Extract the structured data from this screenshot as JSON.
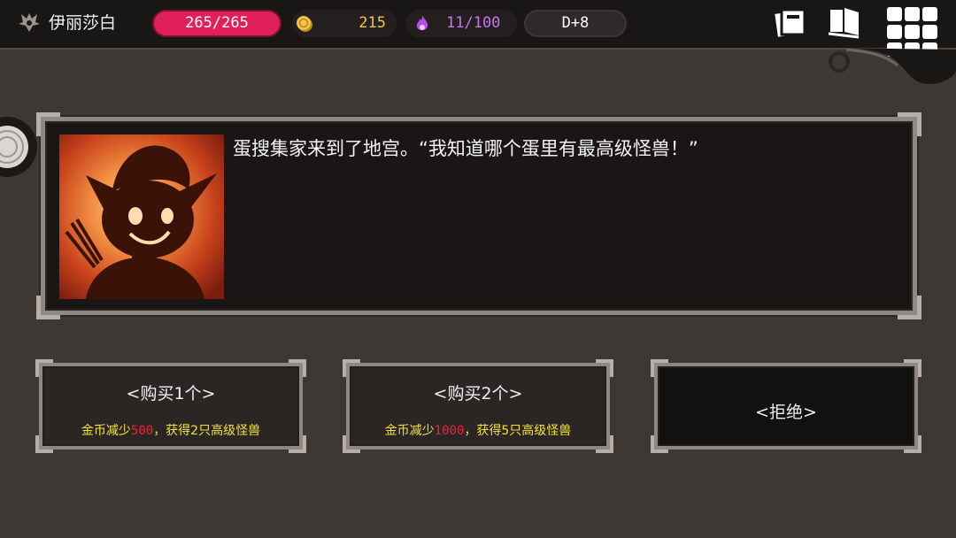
{
  "hud": {
    "player_name": "伊丽莎白",
    "hp": "265/265",
    "gold": "215",
    "souls": "11/100",
    "day": "D+8",
    "icons": {
      "class": "horned-helmet-icon",
      "gold": "gold-coin-icon",
      "souls": "purple-flame-icon",
      "cards": "cards-icon",
      "book": "book-icon",
      "menu": "grid-menu-icon"
    },
    "colors": {
      "hp": "#e0205a",
      "gold": "#f4c446",
      "souls": "#c875f0"
    }
  },
  "event": {
    "portrait": "shadow-egg-collector-portrait",
    "text": "蛋搜集家来到了地宫。“我知道哪个蛋里有最高级怪兽！”"
  },
  "choices": [
    {
      "label": "<购买1个>",
      "desc_prefix": "金币减少",
      "desc_amount": "500",
      "desc_suffix": "，获得2只高级怪兽"
    },
    {
      "label": "<购买2个>",
      "desc_prefix": "金币减少",
      "desc_amount": "1000",
      "desc_suffix": "，获得5只高级怪兽"
    },
    {
      "label": "<拒绝>"
    }
  ],
  "colors": {
    "desc_text": "#f2e33a",
    "desc_amount": "#e8243c",
    "background": "#3d3834"
  }
}
